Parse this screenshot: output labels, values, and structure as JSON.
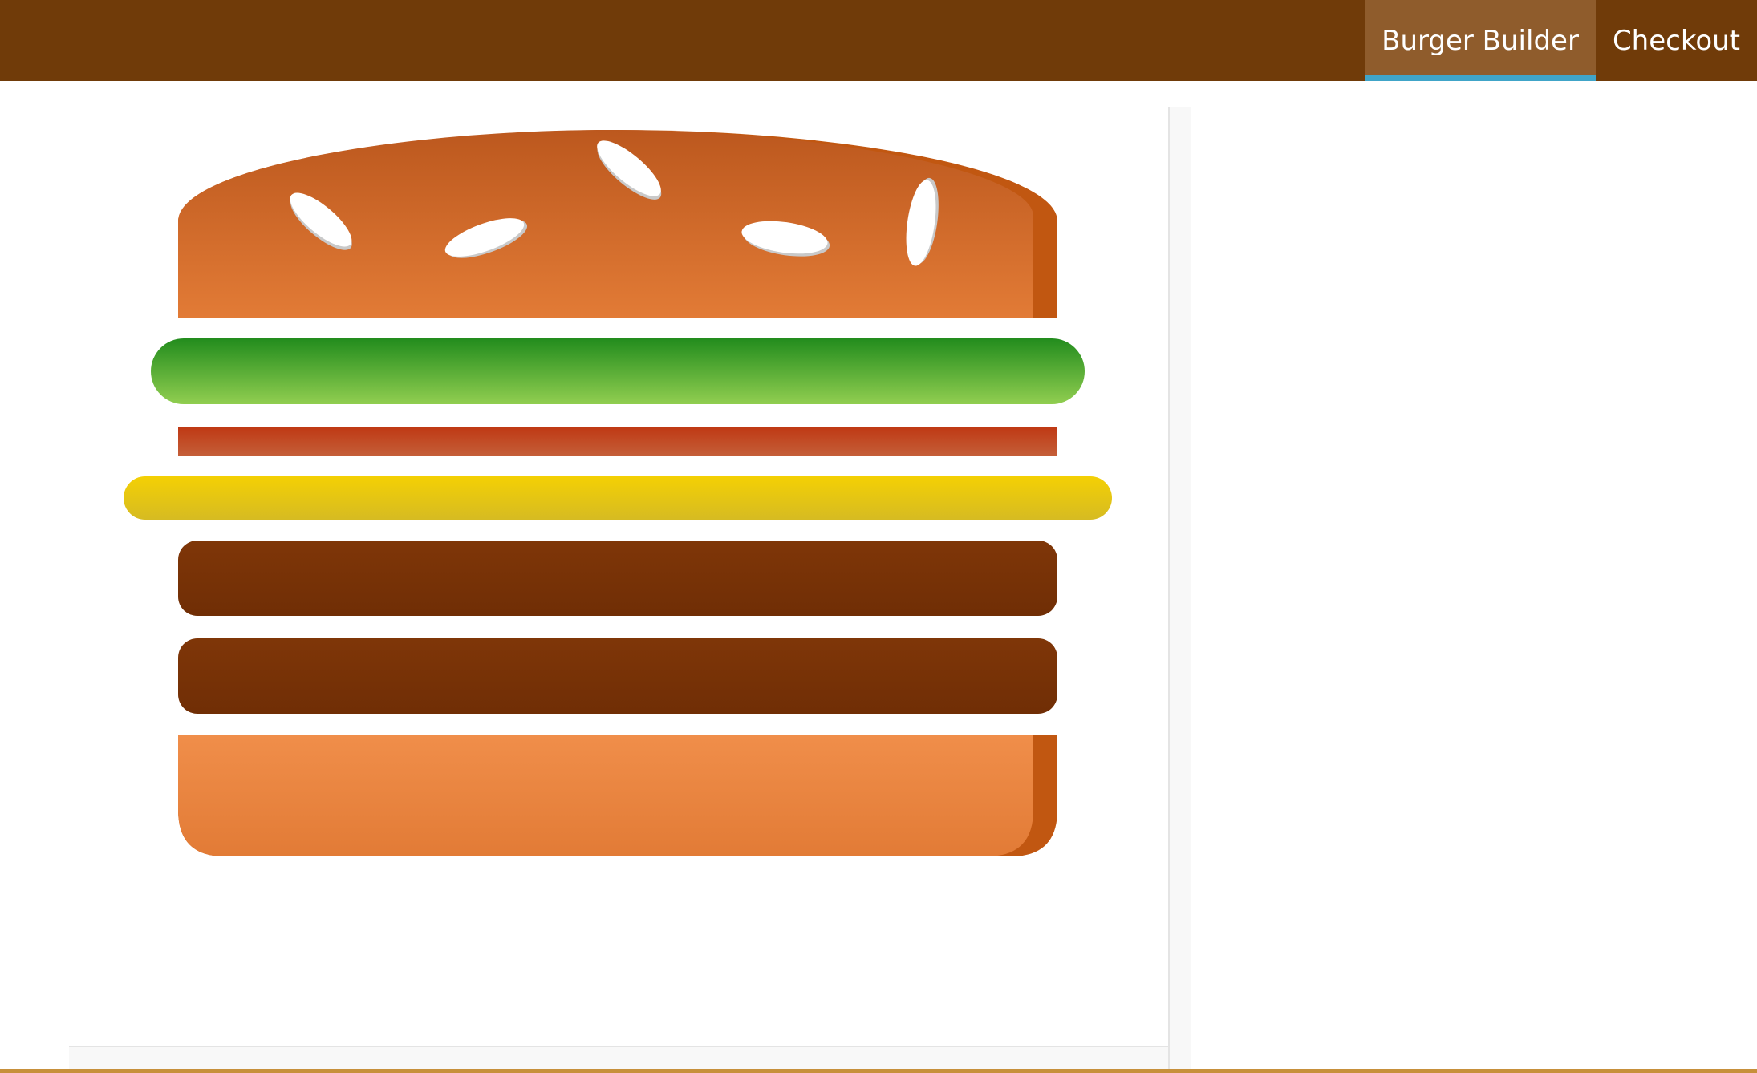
{
  "nav": {
    "items": [
      {
        "label": "Burger Builder",
        "active": true
      },
      {
        "label": "Checkout",
        "active": false
      }
    ]
  },
  "burger": {
    "ingredients": [
      "bread-top",
      "salad",
      "bacon",
      "cheese",
      "meat",
      "meat",
      "bread-bottom"
    ]
  },
  "colors": {
    "toolbar": "#703b09",
    "nav_active_bg": "#8f5c2c",
    "nav_active_border": "#40a4c8",
    "bread": "#e27b36",
    "salad": "#228c1d",
    "bacon": "#bf3813",
    "cheese": "#f4d004",
    "meat": "#7f3608"
  }
}
